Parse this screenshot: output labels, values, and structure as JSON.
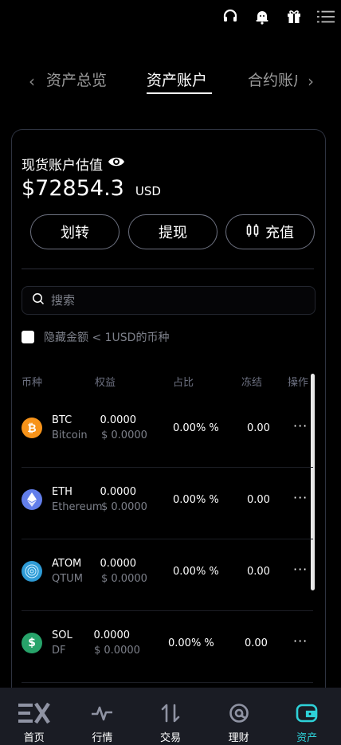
{
  "top_icons": [
    "headset-icon",
    "bell-icon",
    "gift-icon",
    "menu-icon"
  ],
  "tabs": [
    {
      "label": "资产总览",
      "active": false
    },
    {
      "label": "资产账户",
      "active": true
    },
    {
      "label": "合约账户",
      "active": false
    }
  ],
  "account": {
    "label": "现货账户估值",
    "amount": "$72854.3",
    "currency": "USD"
  },
  "actions": {
    "transfer": "划转",
    "withdraw": "提现",
    "deposit": "充值"
  },
  "search": {
    "placeholder": "搜索"
  },
  "hide_small": {
    "label": "隐藏金额 < 1USD的币种",
    "checked": false
  },
  "table": {
    "headers": [
      "币种",
      "权益",
      "占比",
      "冻结",
      "操作"
    ],
    "rows": [
      {
        "symbol": "BTC",
        "name": "Bitcoin",
        "balance": "0.0000",
        "usd": "$ 0.0000",
        "pct": "0.00% %",
        "frozen": "0.00",
        "more": "···",
        "icon": "bitcoin-icon",
        "color": "#f7931a"
      },
      {
        "symbol": "ETH",
        "name": "Ethereum",
        "balance": "0.0000",
        "usd": "$ 0.0000",
        "pct": "0.00% %",
        "frozen": "0.00",
        "more": "···",
        "icon": "ethereum-icon",
        "color": "#627eea"
      },
      {
        "symbol": "ATOM",
        "name": "QTUM",
        "balance": "0.0000",
        "usd": "$ 0.0000",
        "pct": "0.00% %",
        "frozen": "0.00",
        "more": "···",
        "icon": "atom-icon",
        "color": "#2e9bd6"
      },
      {
        "symbol": "SOL",
        "name": "DF",
        "balance": "0.0000",
        "usd": "$ 0.0000",
        "pct": "0.00% %",
        "frozen": "0.00",
        "more": "···",
        "icon": "sol-icon",
        "color": "#27a36a"
      }
    ]
  },
  "nav": [
    {
      "label": "首页",
      "icon": "ex-logo-icon",
      "active": false
    },
    {
      "label": "行情",
      "icon": "pulse-icon",
      "active": false
    },
    {
      "label": "交易",
      "icon": "swap-arrows-icon",
      "active": false
    },
    {
      "label": "理财",
      "icon": "finance-icon",
      "active": false
    },
    {
      "label": "资产",
      "icon": "wallet-icon",
      "active": true
    }
  ],
  "colors": {
    "accent": "#2ed1d8",
    "card_border": "#2e3340",
    "nav_bg": "#1a1c24"
  }
}
